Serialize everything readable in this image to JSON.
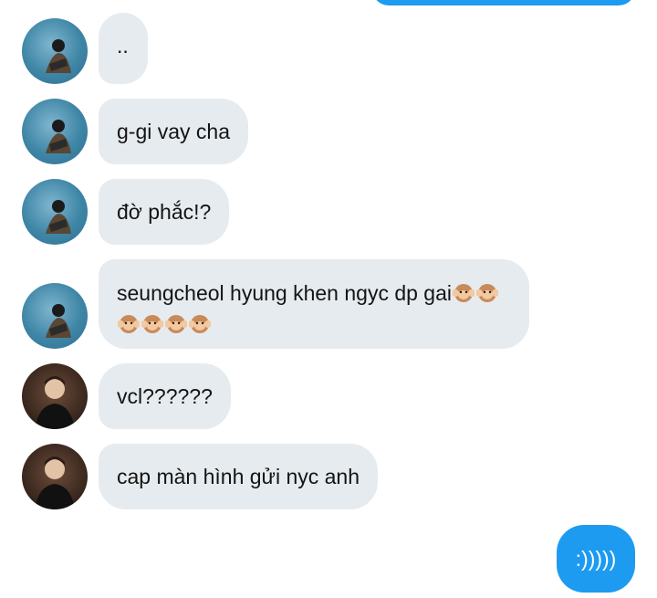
{
  "messages": [
    {
      "sender": "blue",
      "text": ".."
    },
    {
      "sender": "blue",
      "text": "g-gi vay cha"
    },
    {
      "sender": "blue",
      "text": "đờ phắc!?"
    },
    {
      "sender": "blue",
      "text": "seungcheol hyung khen ngyc dp gai",
      "emoji": "🙉",
      "emoji_count_line1": 2,
      "emoji_count_line2": 4
    },
    {
      "sender": "dark",
      "text": "vcl??????"
    },
    {
      "sender": "dark",
      "text": "cap màn hình gửi nyc anh"
    }
  ],
  "outgoing": {
    "text": ":)))))"
  },
  "colors": {
    "bubble_in": "#e6ebef",
    "bubble_out": "#1d9bf0"
  }
}
